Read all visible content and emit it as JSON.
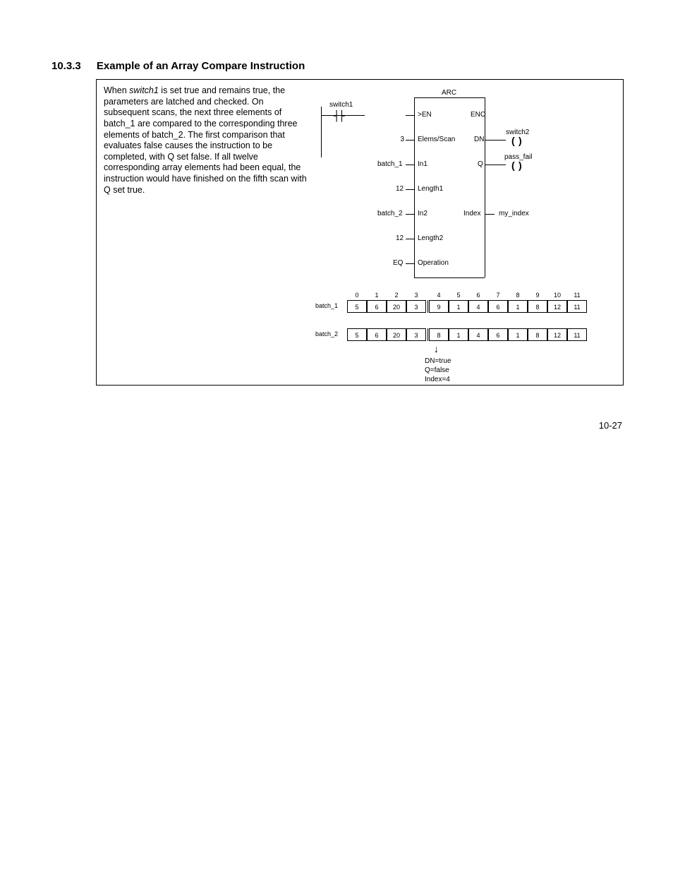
{
  "heading": {
    "number": "10.3.3",
    "title": "Example of an Array Compare Instruction"
  },
  "description": {
    "prefix": "When ",
    "switch": "switch1",
    "body": " is set true and remains true, the parameters are latched and checked. On subsequent scans, the next three elements of batch_1 are compared to the corresponding three elements of batch_2. The first comparison that evaluates false causes the instruction to be completed, with Q set false. If all twelve corresponding array elements had been equal, the instruction would have finished on the fifth scan with Q set true."
  },
  "ladder": {
    "title": "ARC",
    "contact": "switch1",
    "inputs": [
      {
        "label": "",
        "port": ">EN"
      },
      {
        "label": "3",
        "port": "Elems/Scan"
      },
      {
        "label": "batch_1",
        "port": "In1"
      },
      {
        "label": "12",
        "port": "Length1"
      },
      {
        "label": "batch_2",
        "port": "In2"
      },
      {
        "label": "12",
        "port": "Length2"
      },
      {
        "label": "EQ",
        "port": "Operation"
      }
    ],
    "outputs": [
      {
        "port": "ENO",
        "dest": ""
      },
      {
        "port": "DN",
        "dest": "switch2",
        "coil": true
      },
      {
        "port": "Q",
        "dest": "pass_fail",
        "coil": true
      },
      {
        "port": "Index",
        "dest": "my_index"
      }
    ]
  },
  "arrays": {
    "headers": [
      "0",
      "1",
      "2",
      "3",
      "4",
      "5",
      "6",
      "7",
      "8",
      "9",
      "10",
      "11"
    ],
    "batch1": {
      "label": "batch_1",
      "values": [
        "5",
        "6",
        "20",
        "3",
        "9",
        "1",
        "4",
        "6",
        "1",
        "8",
        "12",
        "11"
      ]
    },
    "batch2": {
      "label": "batch_2",
      "values": [
        "5",
        "6",
        "20",
        "3",
        "8",
        "1",
        "4",
        "6",
        "1",
        "8",
        "12",
        "11"
      ]
    },
    "mismatch_index": 4,
    "results": [
      "DN=true",
      "Q=false",
      "Index=4"
    ]
  },
  "page_number": "10-27"
}
